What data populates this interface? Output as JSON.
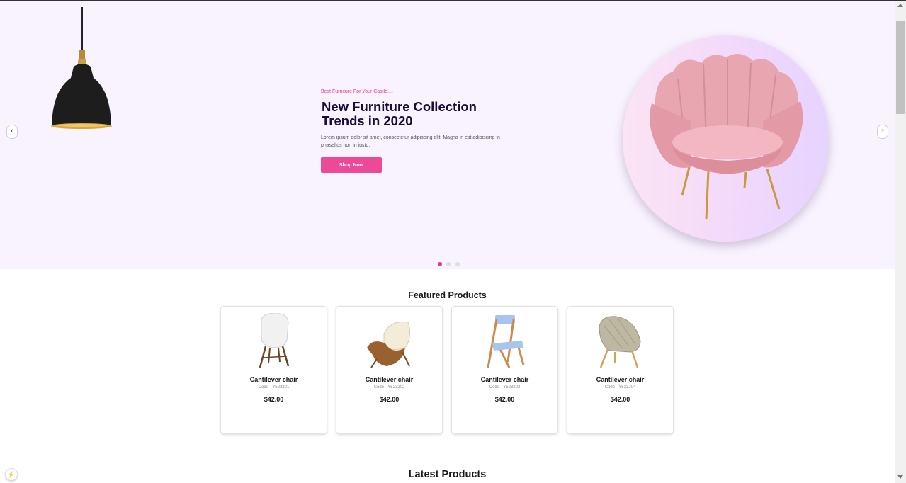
{
  "hero": {
    "eyebrow": "Best Furniture For Your Castle....",
    "title": "New Furniture Collection Trends in 2020",
    "description": "Lorem ipsum dolor sit amet, consectetur adipiscing elit. Magna in est adipiscing in phasellus non in justo.",
    "cta_label": "Shop Now",
    "prev_label": "‹",
    "next_label": "›",
    "slides": 3,
    "active_slide": 1,
    "accent_color": "#ec4a97",
    "background_color": "#f9f3ff"
  },
  "featured": {
    "title": "Featured Products",
    "products": [
      {
        "name": "Cantilever chair",
        "code": "Code - Y523201",
        "price": "$42.00",
        "image": "white-shell-chair"
      },
      {
        "name": "Cantilever chair",
        "code": "Code - Y523202",
        "price": "$42.00",
        "image": "wooden-lounge-chair"
      },
      {
        "name": "Cantilever chair",
        "code": "Code - Y523203",
        "price": "$42.00",
        "image": "blue-seat-wooden-chair"
      },
      {
        "name": "Cantilever chair",
        "code": "Code - Y523204",
        "price": "$42.00",
        "image": "woven-lounge-chair"
      }
    ]
  },
  "latest": {
    "title": "Latest Products"
  },
  "floating_icon": "⚡"
}
